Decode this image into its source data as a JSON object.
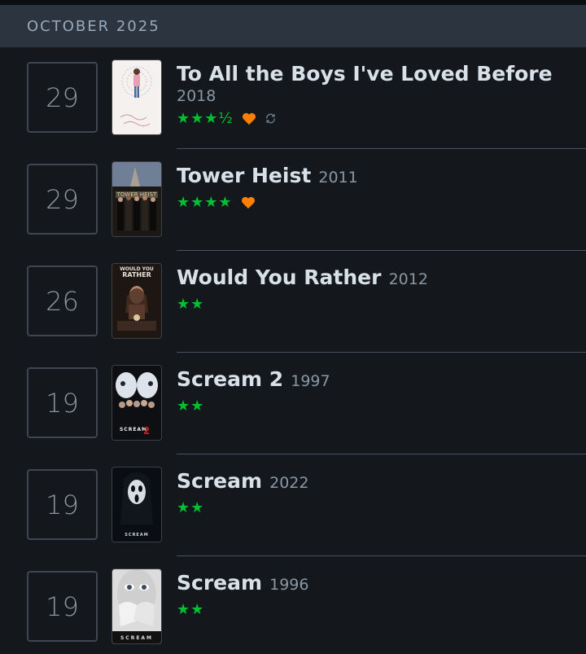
{
  "header": {
    "month": "OCTOBER 2025"
  },
  "colors": {
    "star": "#00c030",
    "heart": "#ff8000",
    "rewatch": "#667788"
  },
  "entries": [
    {
      "day": "29",
      "title": "To All the Boys I've Loved Before",
      "year": "2018",
      "stars": "★★★½",
      "liked": true,
      "rewatch": true,
      "poster": "to-all-the-boys-poster"
    },
    {
      "day": "29",
      "title": "Tower Heist",
      "year": "2011",
      "stars": "★★★★",
      "liked": true,
      "rewatch": false,
      "poster": "tower-heist-poster",
      "poster_text": "TOWER HEIST"
    },
    {
      "day": "26",
      "title": "Would You Rather",
      "year": "2012",
      "stars": "★★",
      "liked": false,
      "rewatch": false,
      "poster": "would-you-rather-poster",
      "poster_text": "WOULD YOU RATHER"
    },
    {
      "day": "19",
      "title": "Scream 2",
      "year": "1997",
      "stars": "★★",
      "liked": false,
      "rewatch": false,
      "poster": "scream-2-poster",
      "poster_text": "SCREAM"
    },
    {
      "day": "19",
      "title": "Scream",
      "year": "2022",
      "stars": "★★",
      "liked": false,
      "rewatch": false,
      "poster": "scream-2022-poster",
      "poster_text": "SCREAM"
    },
    {
      "day": "19",
      "title": "Scream",
      "year": "1996",
      "stars": "★★",
      "liked": false,
      "rewatch": false,
      "poster": "scream-1996-poster",
      "poster_text": "SCREAM"
    }
  ]
}
